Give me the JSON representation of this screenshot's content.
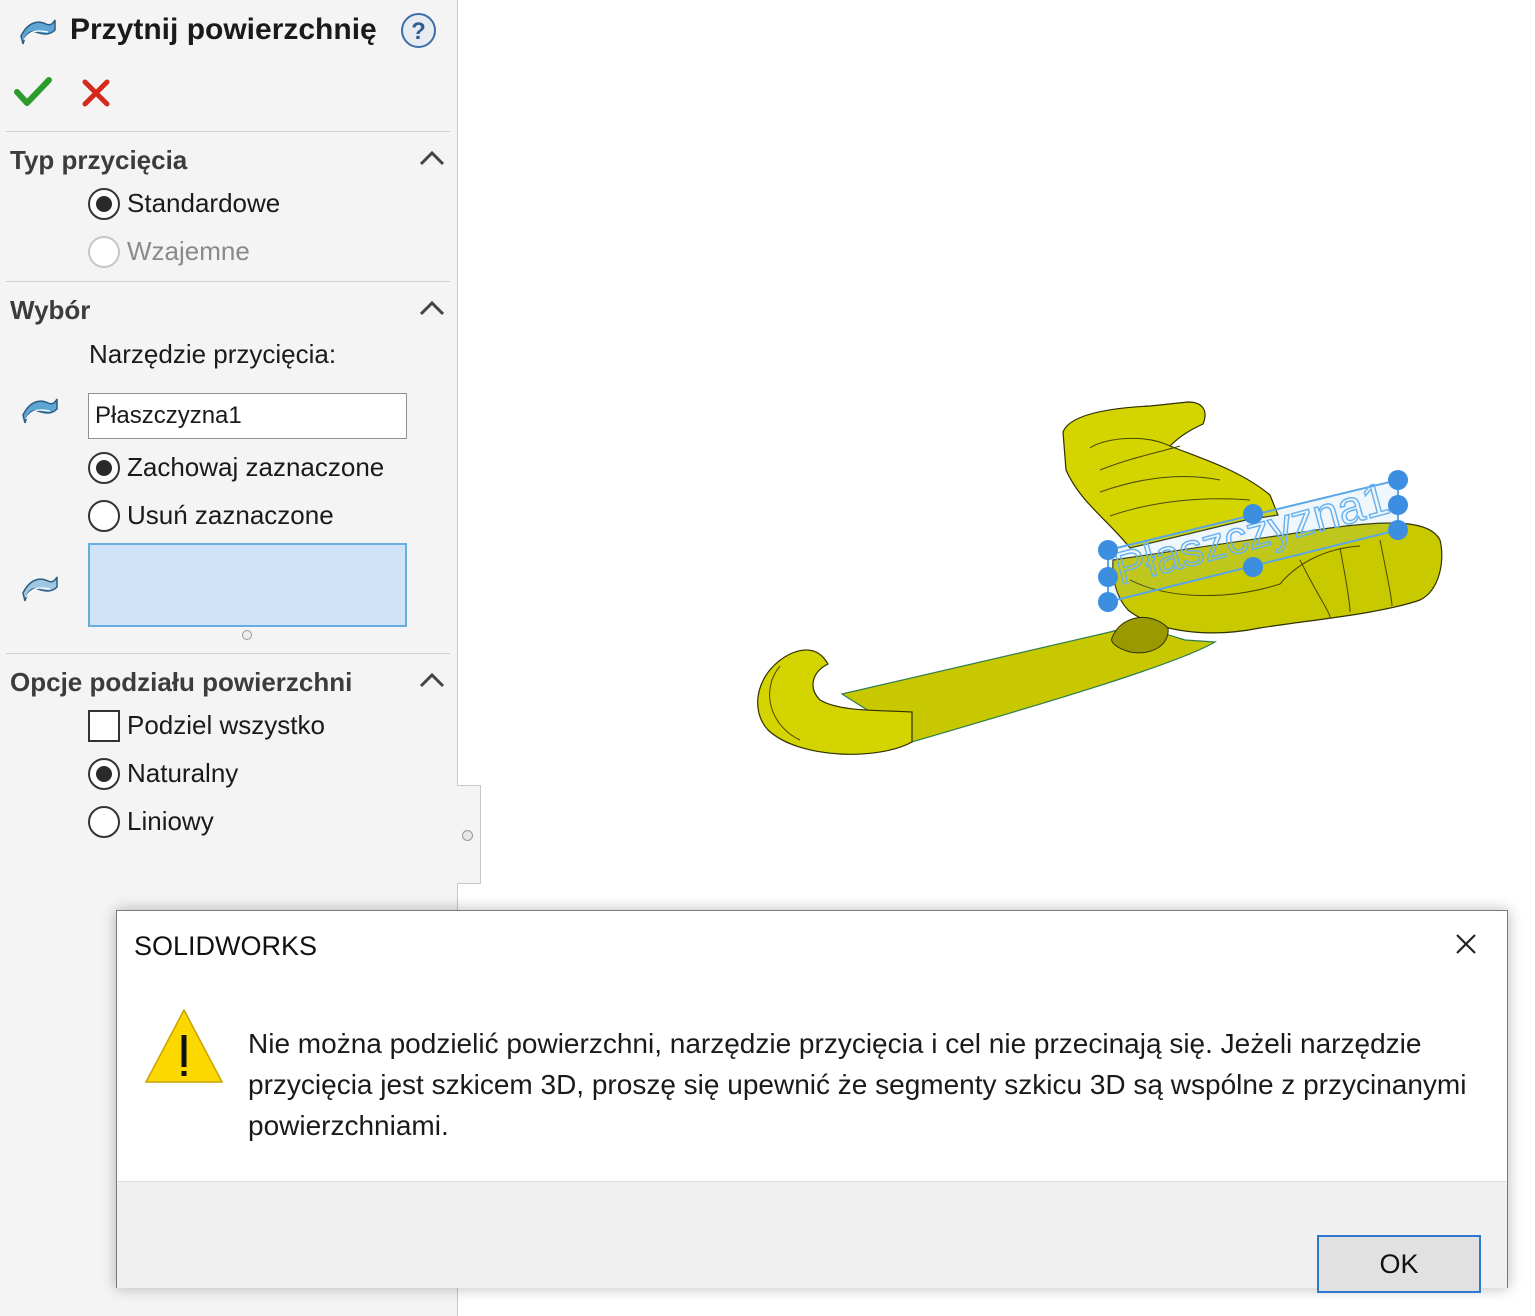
{
  "feature": {
    "title": "Przytnij powierzchnię",
    "icon": "trim-surface-icon",
    "help_icon": "help-icon"
  },
  "actions": {
    "ok_icon": "checkmark-icon",
    "cancel_icon": "close-x-icon"
  },
  "trim_type": {
    "title": "Typ przycięcia",
    "options": [
      {
        "label": "Standardowe",
        "selected": true,
        "enabled": true
      },
      {
        "label": "Wzajemne",
        "selected": false,
        "enabled": false
      }
    ]
  },
  "selection": {
    "title": "Wybór",
    "tool_label": "Narzędzie przycięcia:",
    "tool_value": "Płaszczyzna1",
    "options": [
      {
        "label": "Zachowaj zaznaczone",
        "selected": true
      },
      {
        "label": "Usuń zaznaczone",
        "selected": false
      }
    ]
  },
  "split_options": {
    "title": "Opcje podziału powierzchni",
    "split_all": {
      "label": "Podziel wszystko",
      "checked": false
    },
    "options": [
      {
        "label": "Naturalny",
        "selected": true
      },
      {
        "label": "Liniowy",
        "selected": false
      }
    ]
  },
  "viewport": {
    "plane_label": "Płaszczyzna1",
    "model_color": "#d4d400"
  },
  "dialog": {
    "title": "SOLIDWORKS",
    "message": "Nie można podzielić powierzchni, narzędzie przycięcia i cel nie przecinają się. Jeżeli narzędzie przycięcia jest szkicem 3D, proszę się upewnić że segmenty szkicu 3D są wspólne z przycinanymi powierzchniami.",
    "ok_label": "OK",
    "icon": "warning-icon"
  }
}
